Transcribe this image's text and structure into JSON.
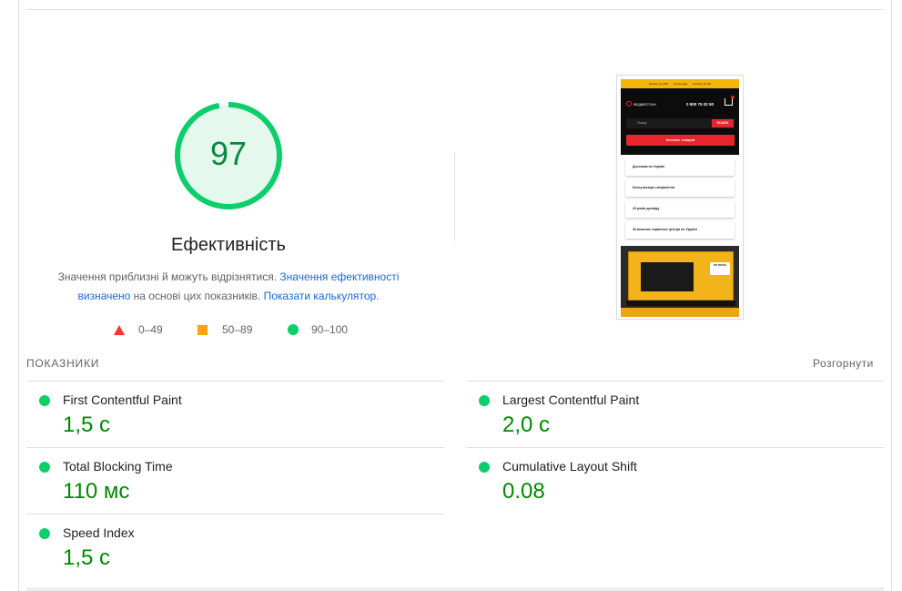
{
  "performance": {
    "score": "97",
    "title": "Ефективність",
    "desc_text": "Значення приблизні й можуть відрізнятися.",
    "desc_link1": "Значення ефективності визначено",
    "desc_mid": "на основі цих показників.",
    "desc_link2": "Показати калькулятор",
    "desc_end": ".",
    "score_fraction": 0.97,
    "colors": {
      "pass": "#0cce6b",
      "pass_text": "#08893e",
      "average": "#ffa400",
      "fail": "#ff3333",
      "link": "#1a67d2"
    }
  },
  "legend": [
    {
      "label": "0–49",
      "icon": "triangle-fail-icon"
    },
    {
      "label": "50–89",
      "icon": "square-average-icon"
    },
    {
      "label": "90–100",
      "icon": "circle-pass-icon"
    }
  ],
  "thumbnail": {
    "topbar": [
      "Знижка до 15%",
      "Розпродаж",
      "Кешбек до 8%"
    ],
    "logo": "ВЕДМЕСТАН",
    "phone": "0 800 75 02 50",
    "search_placeholder": "Пошук",
    "search_button": "ПОШУК",
    "catalog_button": "Каталог товарів",
    "features": [
      "Доставка по Україні",
      "Консультація спеціалістів",
      "20 років досвіду",
      "33 власних сервісних центри по Україні"
    ],
    "product_badge": "EP 20SS3"
  },
  "metrics": {
    "title": "ПОКАЗНИКИ",
    "expand_label": "Розгорнути",
    "items": [
      {
        "name": "First Contentful Paint",
        "value": "1,5 с"
      },
      {
        "name": "Largest Contentful Paint",
        "value": "2,0 с"
      },
      {
        "name": "Total Blocking Time",
        "value": "110 мс"
      },
      {
        "name": "Cumulative Layout Shift",
        "value": "0.08"
      },
      {
        "name": "Speed Index",
        "value": "1,5 с"
      }
    ]
  }
}
